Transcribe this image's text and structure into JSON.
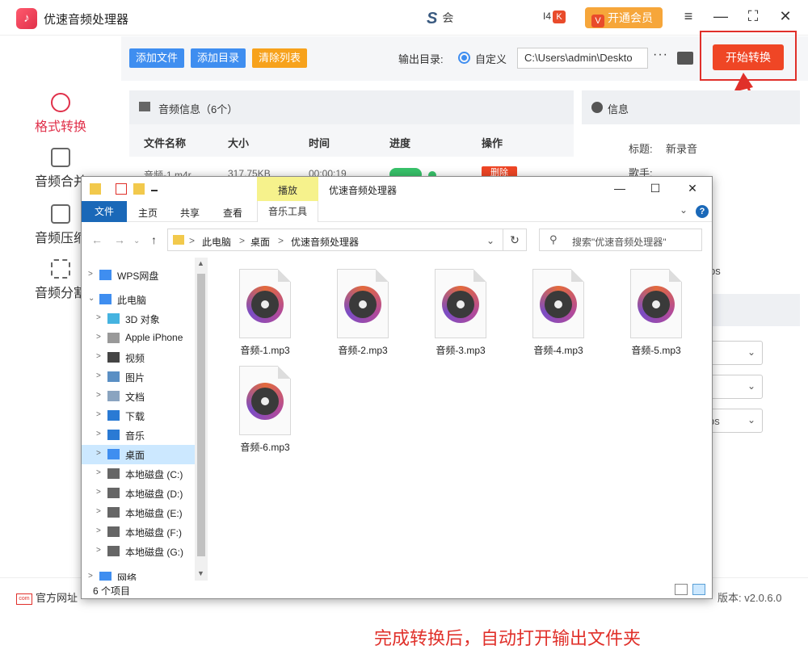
{
  "app": {
    "logo_glyph": "♪",
    "title": "优速音频处理器",
    "extra_text": "会",
    "extra_mark": "S",
    "badge_num": "I4",
    "badge_k": "K",
    "vip_label": "开通会员",
    "vip_mark": "V",
    "menu_icon": "≡",
    "minimize_icon": "—",
    "maximize_icon": "⛶",
    "close_icon": "✕"
  },
  "sidebar": {
    "items": [
      {
        "label": "格式转换",
        "active": true
      },
      {
        "label": "音频合并"
      },
      {
        "label": "音频压缩"
      },
      {
        "label": "音频分割"
      }
    ]
  },
  "toolbar": {
    "add_file": "添加文件",
    "add_dir": "添加目录",
    "clear_list": "清除列表",
    "output_label": "输出目录:",
    "custom_label": "自定义",
    "path_value": "C:\\Users\\admin\\Deskto",
    "more": "···",
    "start_label": "开始转换"
  },
  "list": {
    "header": "音频信息（6个）",
    "columns": [
      "文件名称",
      "大小",
      "时间",
      "进度",
      "操作"
    ],
    "row": {
      "name": "音频-1.m4r",
      "size": "317.75KB",
      "time": "00:00:19",
      "action": "删除"
    }
  },
  "info": {
    "header": "信息",
    "title_label": "标题:",
    "title_value": "新录音",
    "singer_label": "歌手:",
    "bitrate_tail": "ps",
    "sel3_tail": "ps",
    "chevron": "⌄"
  },
  "bottom": {
    "official_icon": "com",
    "official_label": "官方网址",
    "version_label": "版本: v2.0.6.0"
  },
  "explorer": {
    "ctx_tab": "播放",
    "title": "优速音频处理器",
    "min_icon": "—",
    "max_icon": "☐",
    "close_icon": "✕",
    "ribbon": {
      "file": "文件",
      "home": "主页",
      "share": "共享",
      "view": "查看",
      "music_tools": "音乐工具",
      "help_glyph": "?",
      "expand_glyph": "⌄"
    },
    "nav": {
      "back": "←",
      "forward": "→",
      "up": "↑",
      "dropdown": "⌄",
      "refresh": "↻",
      "chevron": ">",
      "search_icon": "⚲"
    },
    "address": [
      "此电脑",
      "桌面",
      "优速音频处理器"
    ],
    "search_placeholder": "搜索\"优速音频处理器\"",
    "tree": [
      {
        "label": "WPS网盘",
        "color": "#3f8ef0"
      },
      {
        "label": "此电脑",
        "color": "#3f8ef0",
        "expanded": true
      },
      {
        "label": "3D 对象",
        "color": "#45b3e0"
      },
      {
        "label": "Apple iPhone",
        "color": "#999999"
      },
      {
        "label": "视频",
        "color": "#444444"
      },
      {
        "label": "图片",
        "color": "#5a8fc4"
      },
      {
        "label": "文档",
        "color": "#8aa4c0"
      },
      {
        "label": "下载",
        "color": "#2a7ad4"
      },
      {
        "label": "音乐",
        "color": "#2a7ad4"
      },
      {
        "label": "桌面",
        "color": "#3f8ef0",
        "selected": true
      },
      {
        "label": "本地磁盘 (C:)",
        "color": "#666666"
      },
      {
        "label": "本地磁盘 (D:)",
        "color": "#666666"
      },
      {
        "label": "本地磁盘 (E:)",
        "color": "#666666"
      },
      {
        "label": "本地磁盘 (F:)",
        "color": "#666666"
      },
      {
        "label": "本地磁盘 (G:)",
        "color": "#666666"
      },
      {
        "label": "网络",
        "color": "#3f8ef0"
      }
    ],
    "files": [
      "音频-1.mp3",
      "音频-2.mp3",
      "音频-3.mp3",
      "音频-4.mp3",
      "音频-5.mp3",
      "音频-6.mp3"
    ],
    "notice": "完成转换后，自动打开输出文件夹",
    "status_count": "6 个项目"
  }
}
